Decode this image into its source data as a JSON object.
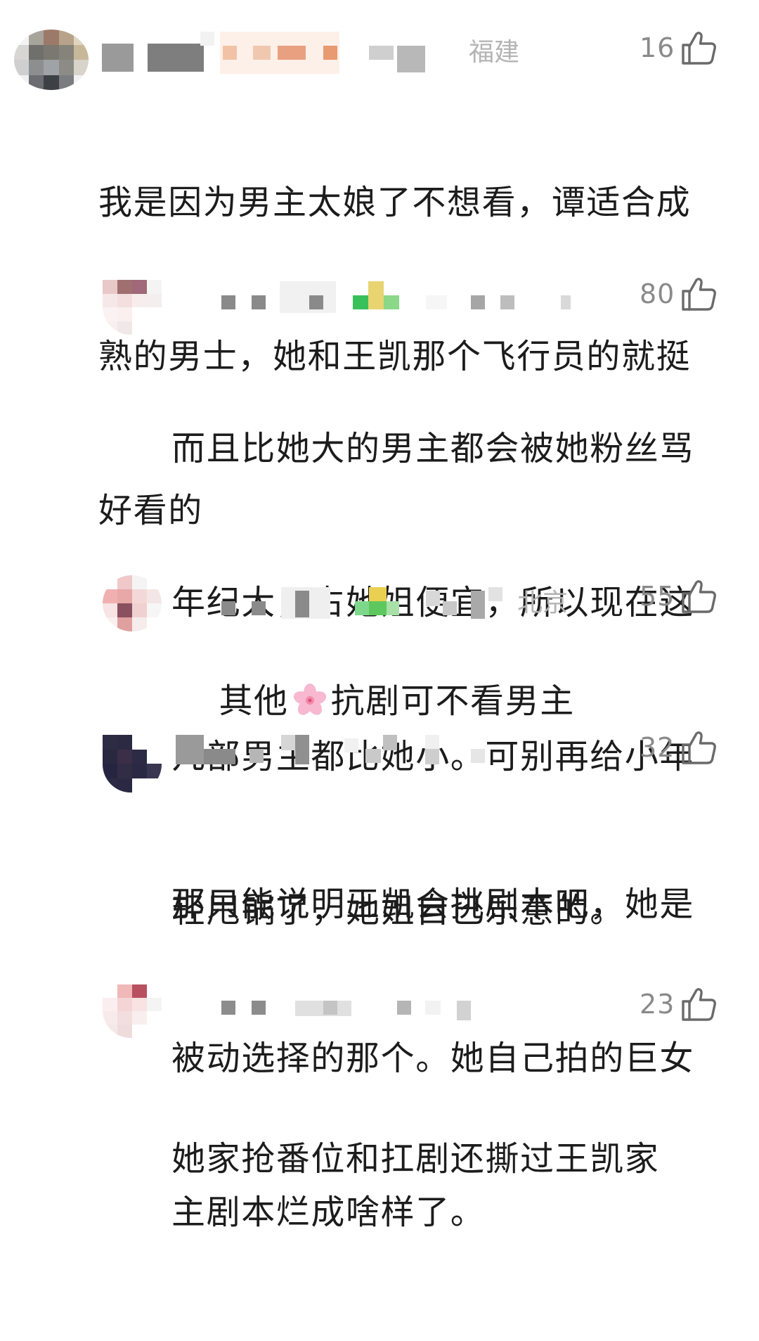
{
  "comments": [
    {
      "location": "福建",
      "likes": "16",
      "text": "我是因为男主太娘了不想看，谭适合成熟的男士，她和王凯那个飞行员的就挺好看的",
      "lines": [
        "我是因为男主太娘了不想看，谭适合成",
        "熟的男士，她和王凯那个飞行员的就挺",
        "好看的"
      ]
    },
    {
      "location": "",
      "likes": "80",
      "lines": [
        "而且比她大的男主都会被她粉丝骂",
        "年纪大，占她姐便宜，所以现在这",
        "几部男主都比她小。可别再给小年",
        "轻甩锅了，她姐自己乐意的。"
      ]
    },
    {
      "location": "北京",
      "likes": "55",
      "text_before": "其他",
      "emoji": "cherry-blossom-icon",
      "text_after": "抗剧可不看男主"
    },
    {
      "location": "",
      "likes": "32",
      "lines": [
        "那只能说明王凯会挑剧本吧，她是",
        "被动选择的那个。她自己拍的巨女",
        "主剧本烂成啥样了。"
      ]
    },
    {
      "location": "",
      "likes": "23",
      "lines": [
        "她家抢番位和扛剧还撕过王凯家"
      ]
    }
  ],
  "colors": {
    "text": "#1c1c1c",
    "meta": "#8a8a8a",
    "location": "#b4b4b4"
  },
  "icons": {
    "like": "thumbs-up-icon",
    "emoji": "cherry-blossom-icon"
  }
}
